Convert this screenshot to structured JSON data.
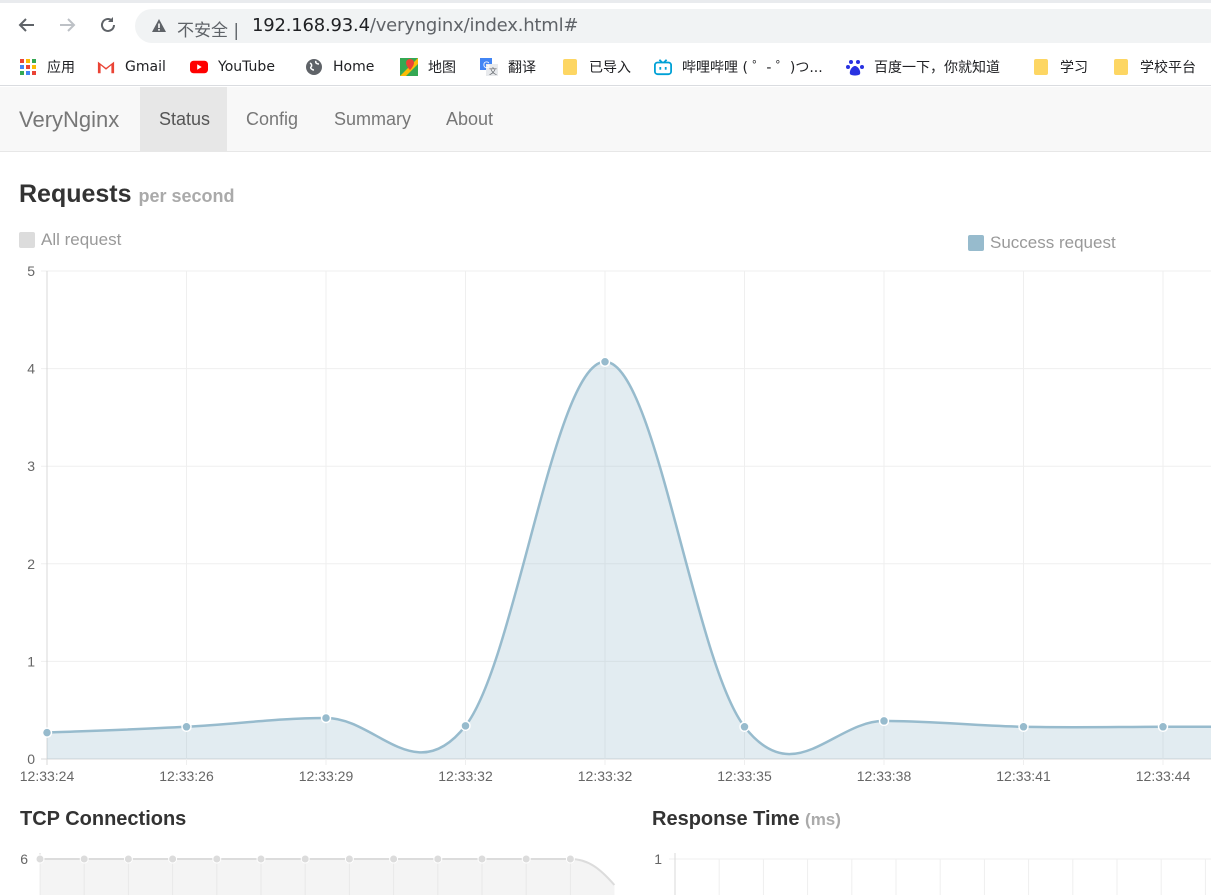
{
  "browser": {
    "security_label": "不安全",
    "url_host": "192.168.93.4",
    "url_path": "/verynginx/index.html#",
    "bookmarks": [
      {
        "label": "应用",
        "icon": "apps-grid-icon"
      },
      {
        "label": "Gmail",
        "icon": "gmail-icon"
      },
      {
        "label": "YouTube",
        "icon": "youtube-icon"
      },
      {
        "label": "Home",
        "icon": "globe-icon"
      },
      {
        "label": "地图",
        "icon": "maps-icon"
      },
      {
        "label": "翻译",
        "icon": "translate-icon"
      },
      {
        "label": "已导入",
        "icon": "folder-icon"
      },
      {
        "label": "哔哩哔哩 ( ゜- ゜)つ...",
        "icon": "bilibili-icon"
      },
      {
        "label": "百度一下，你就知道",
        "icon": "baidu-icon"
      },
      {
        "label": "学习",
        "icon": "folder-icon"
      },
      {
        "label": "学校平台",
        "icon": "folder-icon"
      }
    ]
  },
  "nav": {
    "brand": "VeryNginx",
    "items": [
      {
        "label": "Status",
        "active": true
      },
      {
        "label": "Config",
        "active": false
      },
      {
        "label": "Summary",
        "active": false
      },
      {
        "label": "About",
        "active": false
      }
    ]
  },
  "requests": {
    "title": "Requests",
    "subtitle": "per second",
    "legend_all": "All request",
    "legend_success": "Success request",
    "colors": {
      "all": "#dcdcdc",
      "success": "#97bbcd"
    }
  },
  "tcp": {
    "title": "TCP Connections",
    "y_top_label": "6"
  },
  "response": {
    "title": "Response Time",
    "unit": "(ms)",
    "y_top_label": "1"
  },
  "chart_data": [
    {
      "type": "area",
      "title": "Requests",
      "categories": [
        "12:33:24",
        "12:33:26",
        "12:33:29",
        "12:33:32",
        "12:33:32",
        "12:33:35",
        "12:33:38",
        "12:33:41",
        "12:33:44"
      ],
      "series": [
        {
          "name": "Success request",
          "values": [
            0.27,
            0.33,
            0.42,
            0.34,
            4.07,
            0.33,
            0.39,
            0.33,
            0.33
          ]
        }
      ],
      "ylim": [
        0,
        5
      ],
      "yticks": [
        0,
        1,
        2,
        3,
        4,
        5
      ],
      "grid": true,
      "legend": "top"
    },
    {
      "type": "area",
      "title": "TCP Connections",
      "series": [
        {
          "values": [
            6,
            6,
            6,
            6,
            6,
            6,
            6,
            6,
            6,
            6,
            6,
            6,
            6
          ]
        }
      ],
      "yticks": [
        6
      ],
      "grid": true
    },
    {
      "type": "line",
      "title": "Response Time",
      "yticks": [
        1
      ],
      "grid": true
    }
  ]
}
